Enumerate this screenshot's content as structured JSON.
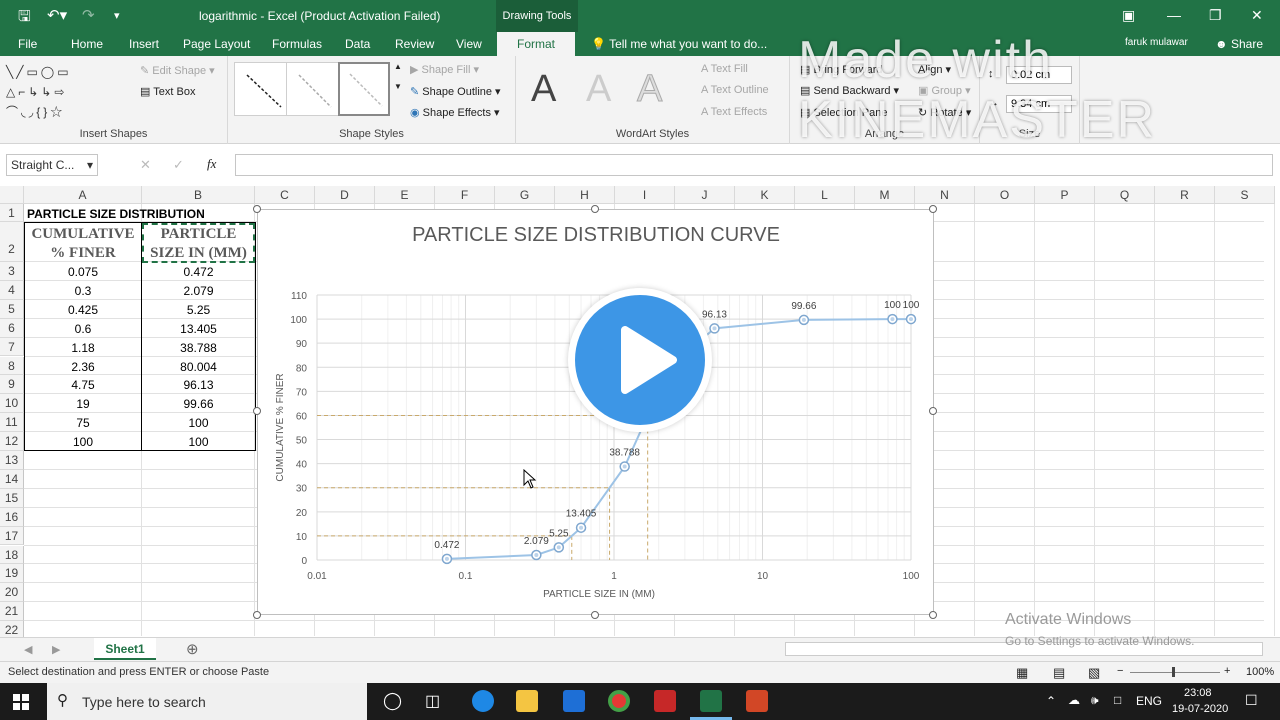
{
  "window": {
    "title": "logarithmic - Excel (Product Activation Failed)",
    "context_tab": "Drawing Tools",
    "user": "faruk mulawar",
    "share": "Share"
  },
  "tabs": [
    "File",
    "Home",
    "Insert",
    "Page Layout",
    "Formulas",
    "Data",
    "Review",
    "View",
    "Format"
  ],
  "tell_me": "Tell me what you want to do...",
  "ribbon": {
    "insert_shapes": {
      "label": "Insert Shapes",
      "edit_shape": "Edit Shape",
      "text_box": "Text Box"
    },
    "shape_styles": {
      "label": "Shape Styles",
      "fill": "Shape Fill",
      "outline": "Shape Outline",
      "effects": "Shape Effects"
    },
    "wordart": {
      "label": "WordArt Styles",
      "text_fill": "Text Fill",
      "text_outline": "Text Outline",
      "text_effects": "Text Effects",
      "glyph": "A"
    },
    "arrange": {
      "label": "Arrange",
      "bring_forward": "Bring Forward",
      "send_backward": "Send Backward",
      "selection_pane": "Selection Pane",
      "align": "Align",
      "group": "Group",
      "rotate": "Rotate"
    },
    "size": {
      "label": "Size",
      "height": "0.02 cm",
      "width": "9.34 cm"
    }
  },
  "name_box": "Straight C...",
  "columns": [
    "A",
    "B",
    "C",
    "D",
    "E",
    "F",
    "G",
    "H",
    "I",
    "J",
    "K",
    "L",
    "M",
    "N",
    "O",
    "P",
    "Q",
    "R",
    "S"
  ],
  "rows": [
    "1",
    "2",
    "3",
    "4",
    "5",
    "6",
    "7",
    "8",
    "9",
    "10",
    "11",
    "12",
    "13",
    "14",
    "15",
    "16",
    "17",
    "18",
    "19",
    "20",
    "21",
    "22"
  ],
  "sheet": {
    "title": "PARTICLE SIZE DISTRIBUTION",
    "header_a": [
      "CUMULATIVE",
      "% FINER"
    ],
    "header_b": [
      "PARTICLE",
      "SIZE IN (MM)"
    ],
    "col_a": [
      "0.075",
      "0.3",
      "0.425",
      "0.6",
      "1.18",
      "2.36",
      "4.75",
      "19",
      "75",
      "100"
    ],
    "col_b": [
      "0.472",
      "2.079",
      "5.25",
      "13.405",
      "38.788",
      "80.004",
      "96.13",
      "99.66",
      "100",
      "100"
    ]
  },
  "sheet_tab": "Sheet1",
  "status": "Select destination and press ENTER or choose Paste",
  "zoom": "100%",
  "chart_data": {
    "type": "scatter",
    "title": "PARTICLE SIZE DISTRIBUTION CURVE",
    "xlabel": "PARTICLE SIZE IN (MM)",
    "ylabel": "CUMULATIVE % FINER",
    "x_scale": "log",
    "xlim": [
      0.01,
      100
    ],
    "ylim": [
      0,
      110
    ],
    "x_ticks": [
      "0.01",
      "0.1",
      "1",
      "10",
      "100"
    ],
    "y_ticks": [
      "0",
      "10",
      "20",
      "30",
      "40",
      "50",
      "60",
      "70",
      "80",
      "90",
      "100",
      "110"
    ],
    "x": [
      0.075,
      0.3,
      0.425,
      0.6,
      1.18,
      2.36,
      4.75,
      19,
      75,
      100
    ],
    "y": [
      0.472,
      2.079,
      5.25,
      13.405,
      38.788,
      80.004,
      96.13,
      99.66,
      100,
      100
    ],
    "point_labels": [
      "0.472",
      "2.079",
      "5.25",
      "13.405",
      "38.788",
      "80.004",
      "96.13",
      "99.66",
      "100",
      "100"
    ],
    "grid": true,
    "series_color": "#9dc3e6",
    "guide_lines": [
      10,
      30,
      60
    ],
    "guide_color": "#c9a96b"
  },
  "overlay": {
    "watermark": "Made with KINEMASTER",
    "activate_title": "Activate Windows",
    "activate_sub": "Go to Settings to activate Windows."
  },
  "taskbar": {
    "search": "Type here to search",
    "lang": "ENG",
    "time": "23:08",
    "date": "19-07-2020"
  },
  "colors": {
    "excel_green": "#217346",
    "taskbar": "#1b1b1b",
    "play": "#3d96e6"
  }
}
